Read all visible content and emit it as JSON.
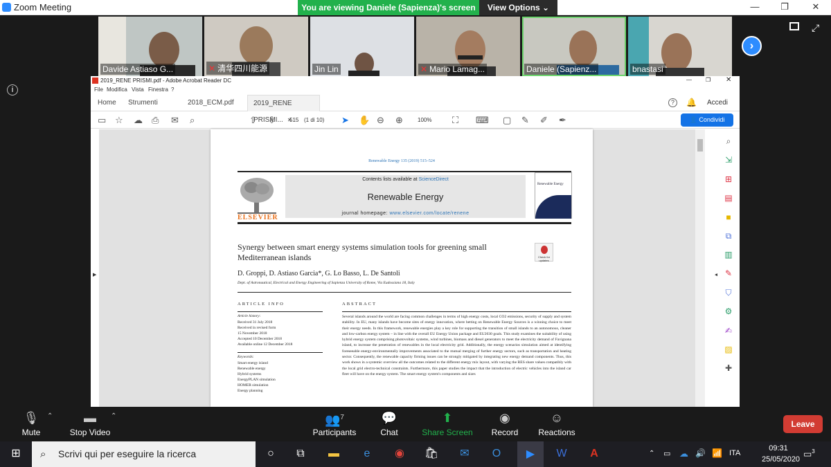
{
  "window": {
    "title": "Zoom Meeting",
    "banner": "You are viewing Daniele (Sapienza)'s screen",
    "view_options": "View Options ⌄"
  },
  "participants": [
    {
      "name": "Davide Astiaso G...",
      "muted": false
    },
    {
      "name": "清华四川能源",
      "muted": true
    },
    {
      "name": "Jin Lin",
      "muted": false
    },
    {
      "name": "Mario Lamag...",
      "muted": true
    },
    {
      "name": "Daniele (Sapienz...",
      "muted": false,
      "active": true
    },
    {
      "name": "bnastasi",
      "muted": false
    }
  ],
  "acrobat": {
    "title": "2019_RENE PRISMI.pdf - Adobe Acrobat Reader DC",
    "menu": [
      "File",
      "Modifica",
      "Vista",
      "Finestra",
      "?"
    ],
    "tabs": [
      "Home",
      "Strumenti",
      "2018_ECM.pdf",
      "2019_RENE PRISMI..."
    ],
    "accedi": "Accedi",
    "page_number": "515",
    "page_of": "(1 di 10)",
    "zoom": "100%",
    "share": "Condividi"
  },
  "paper": {
    "journal_ref": "Renewable Energy 135 (2019) 515–524",
    "contents_prefix": "Contents lists available at",
    "contents_link": "ScienceDirect",
    "journal_name": "Renewable Energy",
    "homepage_prefix": "journal homepage:",
    "homepage_url": "www.elsevier.com/locate/renene",
    "publisher": "ELSEVIER",
    "cover_title": "Renewable Energy",
    "check_updates": "Check for updates",
    "title": "Synergy between smart energy systems simulation tools for greening small Mediterranean islands",
    "authors": "D. Groppi, D. Astiaso Garcia*, G. Lo Basso, L. De Santoli",
    "affiliation": "Dept. of Astronautical, Electrical and Energy Engineering of Sapienza University of Rome, Via Eudossiana 18, Italy",
    "article_info_heading": "ARTICLE INFO",
    "abstract_heading": "ABSTRACT",
    "history_label": "Article history:",
    "history": [
      "Received 31 July 2018",
      "Received in revised form",
      "15 November 2018",
      "Accepted 10 December 2018",
      "Available online 12 December 2018"
    ],
    "keywords_label": "Keywords:",
    "keywords": [
      "Smart energy island",
      "Renewable energy",
      "Hybrid systems",
      "EnergyPLAN simulation",
      "HOMER simulation",
      "Energy planning"
    ],
    "abstract": "Several islands around the world are facing common challenges in terms of high energy costs, local CO2 emissions, security of supply and system stability. In EU, many islands have become sites of energy innovation, where betting on Renewable Energy Sources is a winning choice to meet their energy needs. In this framework, renewable energies play a key role for supporting the transition of small islands to an autonomous, cleaner and low-carbon energy system – in line with the overall EU Energy Union package and EU2030 goals. This study examines the suitability of using hybrid energy system comprising photovoltaic systems, wind turbines, biomass and diesel generators to meet the electricity demand of Favignana island, to increase the penetration of renewables in the local electricity grid. Additionally, the energy scenarios simulation aimed at identifying foreseeable energy-environmentally improvements associated to the mutual merging of further energy sectors, such as transportation and heating sector. Consequently, the renewable capacity firming issues can be strongly mitigated by integrating new energy demand components. Thus, this work shows in a systemic overview all the outcomes related to the different energy mix layout, with varying the RES share values compatibly with the local grid electro-technical constraints. Furthermore, this paper studies the impact that the introduction of electric vehicles into the island car fleet will have on the energy system. The smart energy system's components and sizes"
  },
  "controls": {
    "mute": "Mute",
    "stop_video": "Stop Video",
    "participants": "Participants",
    "participants_count": "7",
    "chat": "Chat",
    "share_screen": "Share Screen",
    "record": "Record",
    "reactions": "Reactions",
    "leave": "Leave"
  },
  "taskbar": {
    "search_placeholder": "Scrivi qui per eseguire la ricerca",
    "lang": "ITA",
    "time": "09:31",
    "date": "25/05/2020",
    "notifications": "3"
  },
  "colors": {
    "zoom_blue": "#2d8cff",
    "banner_green": "#22b14c",
    "leave_red": "#d23c33",
    "acrobat_blue": "#1473e6",
    "elsevier_orange": "#e9711c"
  }
}
